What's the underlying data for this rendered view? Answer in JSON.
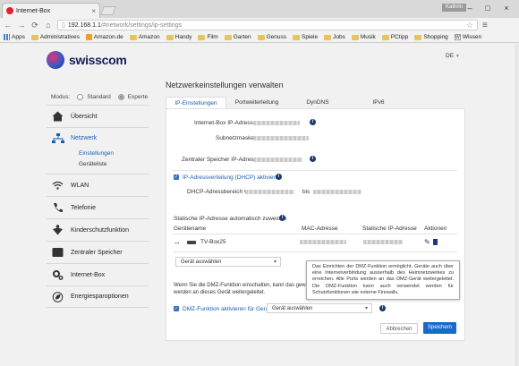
{
  "browser": {
    "tab_title": "Internet-Box",
    "user_badge": "Kathrin",
    "url_host": "192.168.1.1",
    "url_path": "/#network/settings/ip-settings",
    "bookmarks": [
      "Apps",
      "Administratives",
      "Amazon.de",
      "Amazon",
      "Handy",
      "Film",
      "Garten",
      "Genuss",
      "Spiele",
      "Jobs",
      "Musik",
      "PCtipp",
      "Shopping",
      "Wissen"
    ]
  },
  "header": {
    "logo_text": "swisscom",
    "lang": "DE",
    "page_title": "Netzwerkeinstellungen verwalten"
  },
  "mode": {
    "label": "Modus:",
    "options": [
      "Standard",
      "Experte"
    ],
    "selected": "Experte"
  },
  "sidebar": {
    "items": [
      {
        "label": "Übersicht",
        "icon": "home-icon"
      },
      {
        "label": "Netzwerk",
        "icon": "network-icon"
      },
      {
        "label": "WLAN",
        "icon": "wifi-icon"
      },
      {
        "label": "Telefonie",
        "icon": "phone-icon"
      },
      {
        "label": "Kinderschutzfunktion",
        "icon": "child-protection-icon"
      },
      {
        "label": "Zentraler Speicher",
        "icon": "storage-icon"
      },
      {
        "label": "Internet-Box",
        "icon": "gear-icon"
      },
      {
        "label": "Energiesparoptionen",
        "icon": "leaf-icon"
      }
    ],
    "subitems": [
      "Einstellungen",
      "Geräteliste"
    ]
  },
  "tabs": [
    "IP-Einstellungen",
    "Portweiterleitung",
    "DynDNS",
    "IPv6"
  ],
  "form": {
    "ip_label": "Internet-Box IP-Adresse",
    "subnet_label": "Subnetzmaske",
    "storage_ip_label": "Zentraler Speicher IP-Adresse",
    "dhcp_label": "IP-Adressverteilung (DHCP) aktivieren",
    "dhcp_range_label": "DHCP-Adressbereich von",
    "dhcp_range_to": "bis",
    "static_heading": "Statische IP-Adresse automatisch zuweisen",
    "col_device": "Gerätename",
    "col_mac": "MAC-Adresse",
    "col_static_ip": "Statische IP-Adresse",
    "col_actions": "Aktionen",
    "device_name": "TV-Box25",
    "device_select": "Gerät auswählen",
    "dmz_text": "Wenn Sie die DMZ-Funktion einschalten, kann das gewählte Gerät auch über eine Internetverbindung ausserhalb des Heimnetzwerkes zu werden an dieses Gerät weitergeleitet.",
    "dmz_text_line1": "Wenn Sie die DMZ-Funktion einschalten, kann das gewäh",
    "dmz_text_line2": "werden an dieses Gerät weitergeleitet.",
    "dmz_checkbox_label": "DMZ-Funktion aktivieren für Gerät",
    "dmz_select": "Gerät auswählen"
  },
  "tooltip": "Das Einrichten der DMZ-Funktion ermöglicht, Geräte auch über eine Internetverbindung ausserhalb des Heimnetzwerkes zu erreichen. Alle Ports werden an das DMZ-Gerät weitergeleitet. Die DMZ-Funktion kann auch verwendet werden für Schutzfunktionen wie externe Firewalls.",
  "buttons": {
    "cancel": "Abbrechen",
    "save": "Speichern"
  },
  "colors": {
    "accent": "#1a5fb4",
    "save_button": "#1a6ac9"
  }
}
